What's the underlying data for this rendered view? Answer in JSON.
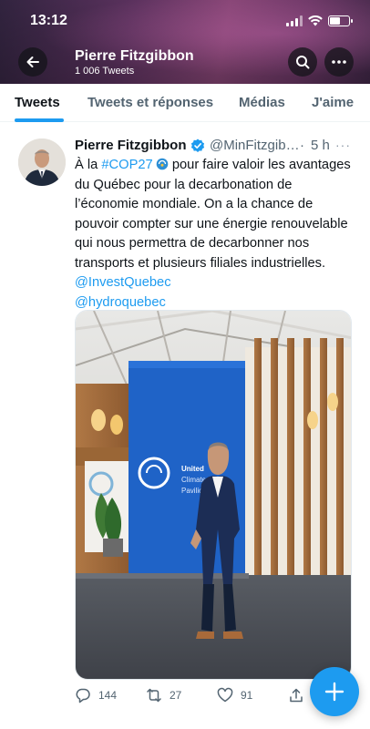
{
  "status_bar": {
    "time": "13:12"
  },
  "header": {
    "name": "Pierre Fitzgibbon",
    "tweet_count": "1 006 Tweets",
    "icons": {
      "back": "back-arrow-icon",
      "search": "search-icon",
      "more": "more-icon"
    }
  },
  "tabs": [
    {
      "label": "Tweets",
      "active": true
    },
    {
      "label": "Tweets et réponses",
      "active": false
    },
    {
      "label": "Médias",
      "active": false
    },
    {
      "label": "J'aime",
      "active": false
    }
  ],
  "tweet": {
    "author": "Pierre Fitzgibbon",
    "handle": "@MinFitzgib…",
    "separator": "·",
    "time": "5 h",
    "more": "···",
    "text": {
      "part1": "À la ",
      "hashtag": "#COP27",
      "part2": " pour faire valoir les avantages du Québec pour la decarbonation de l’économie mondiale. On a la chance de pouvoir compter sur une énergie renouvelable qui nous permettra de decarbonner nos transports et plusieurs filiales industrielles. ",
      "mention1": "@InvestQuebec",
      "mention2": "@hydroquebec"
    },
    "media": {
      "banner_lines": [
        "United",
        "Climate",
        "Pavilion"
      ]
    },
    "actions": {
      "replies": "144",
      "retweets": "27",
      "likes": "91"
    }
  },
  "colors": {
    "accent": "#1d9bf0",
    "text": "#0f1419",
    "muted": "#536471"
  }
}
